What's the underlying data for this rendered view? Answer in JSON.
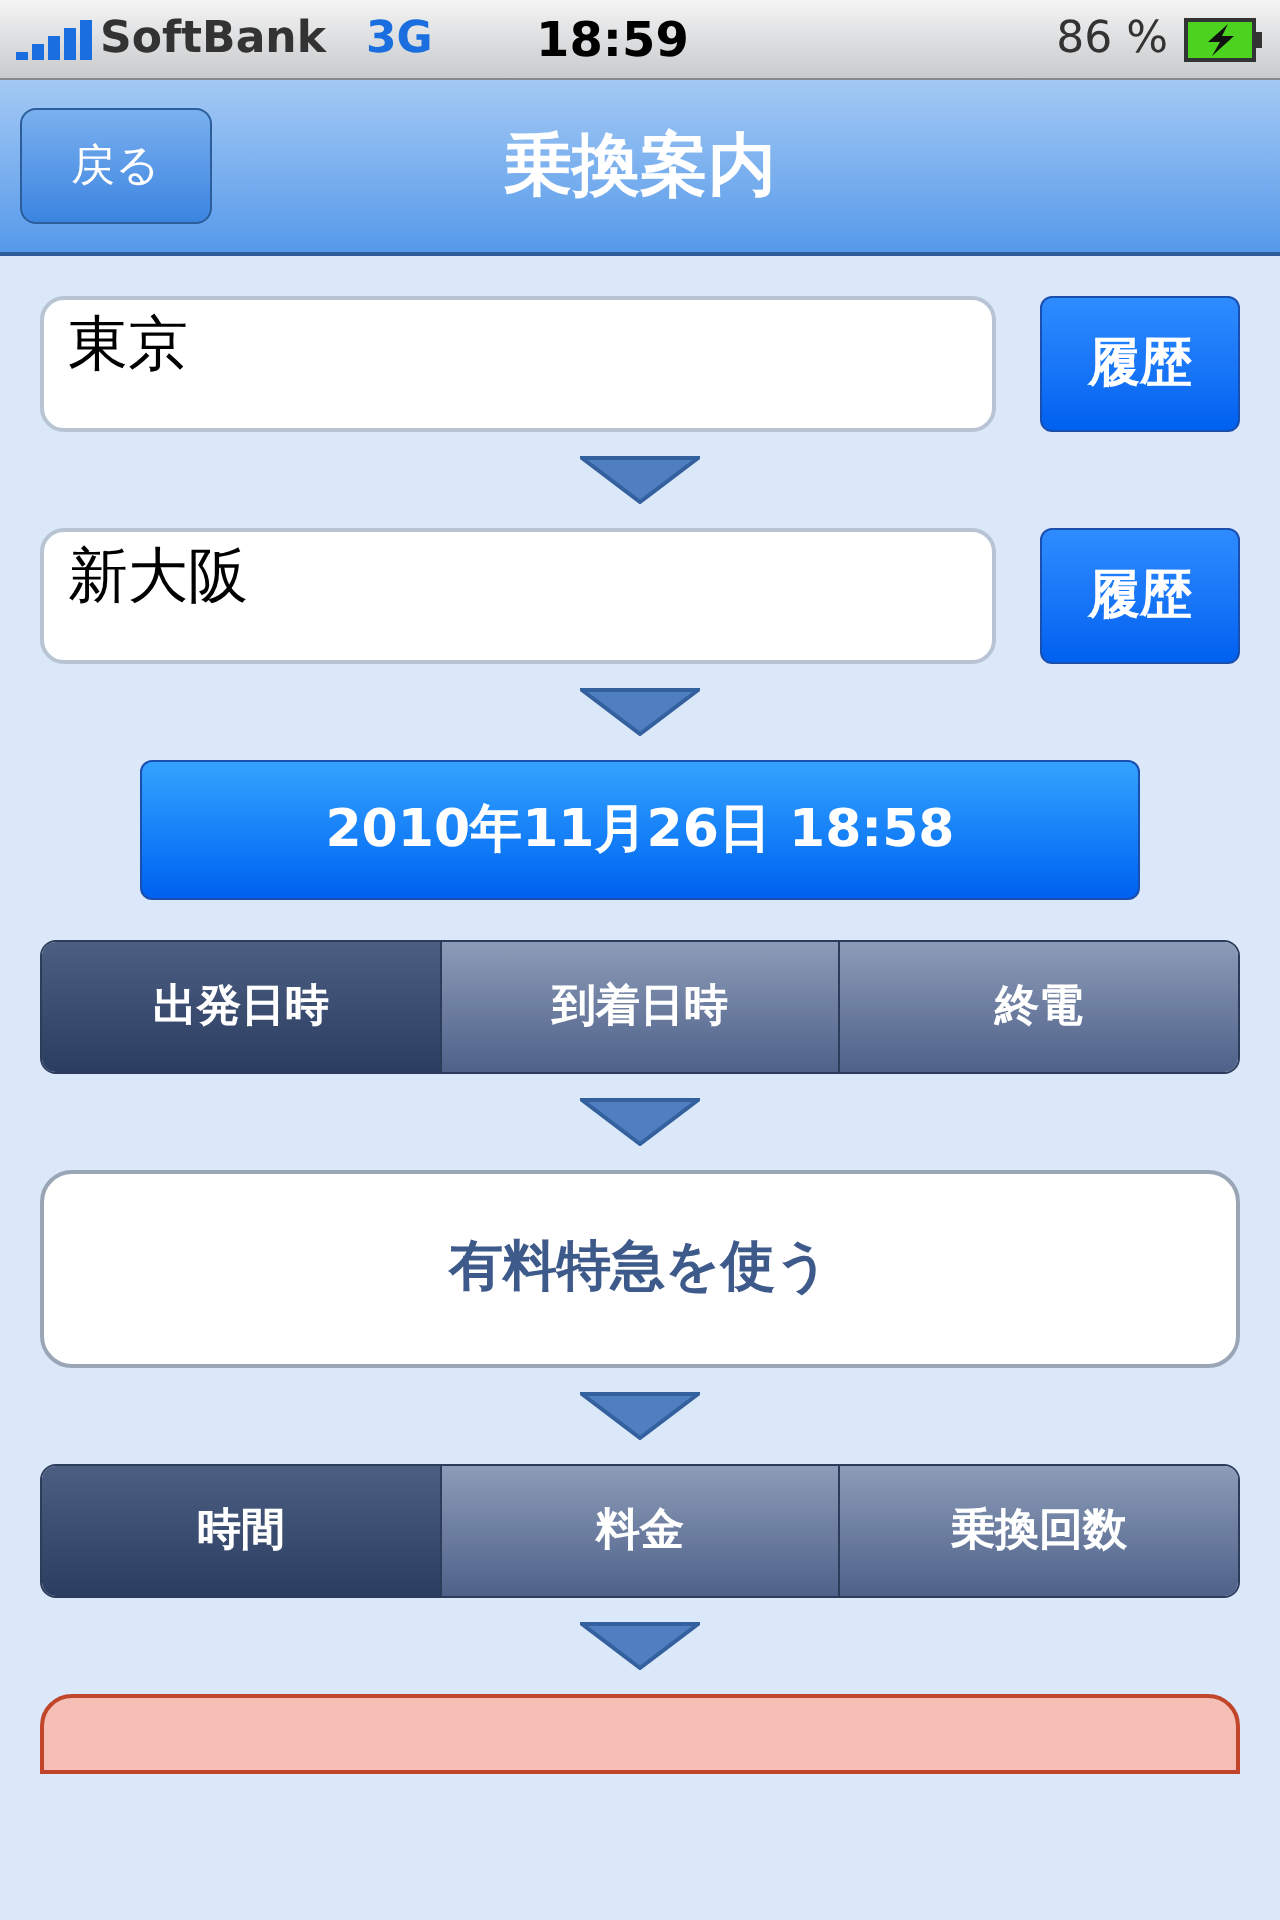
{
  "status_bar": {
    "carrier": "SoftBank",
    "network": "3G",
    "time": "18:59",
    "battery": "86 %"
  },
  "nav": {
    "back": "戻る",
    "title": "乗換案内"
  },
  "stations": [
    {
      "value": "東京",
      "history": "履歴"
    },
    {
      "value": "新大阪",
      "history": "履歴"
    }
  ],
  "datetime": "2010年11月26日 18:58",
  "time_mode": [
    {
      "label": "出発日時",
      "selected": true
    },
    {
      "label": "到着日時",
      "selected": false
    },
    {
      "label": "終電",
      "selected": false
    }
  ],
  "express": "有料特急を使う",
  "sort": [
    {
      "label": "時間",
      "selected": true
    },
    {
      "label": "料金",
      "selected": false
    },
    {
      "label": "乗換回数",
      "selected": false
    }
  ]
}
